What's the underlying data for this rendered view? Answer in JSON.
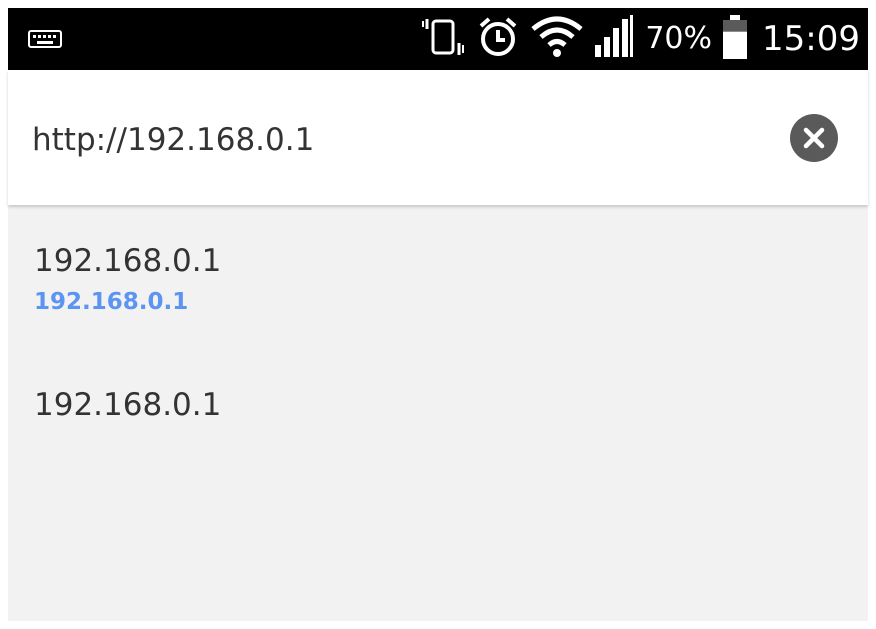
{
  "status_bar": {
    "keyboard_icon": "keyboard-icon",
    "vibrate_icon": "vibrate-icon",
    "alarm_icon": "alarm-clock-icon",
    "wifi_icon": "wifi-icon",
    "signal_icon": "cell-signal-icon",
    "battery_percent": "70%",
    "battery_icon": "battery-icon",
    "battery_level": 0.7,
    "time": "15:09"
  },
  "address_bar": {
    "value": "http://192.168.0.1",
    "clear_icon": "close-circle-icon"
  },
  "suggestions": [
    {
      "title": "192.168.0.1",
      "url": "192.168.0.1"
    },
    {
      "title": "192.168.0.1"
    }
  ],
  "colors": {
    "status_bar_bg": "#000000",
    "suggestion_bg": "#f2f2f2",
    "url_accent": "#5c94f2",
    "clear_button": "#5a5a5a"
  }
}
